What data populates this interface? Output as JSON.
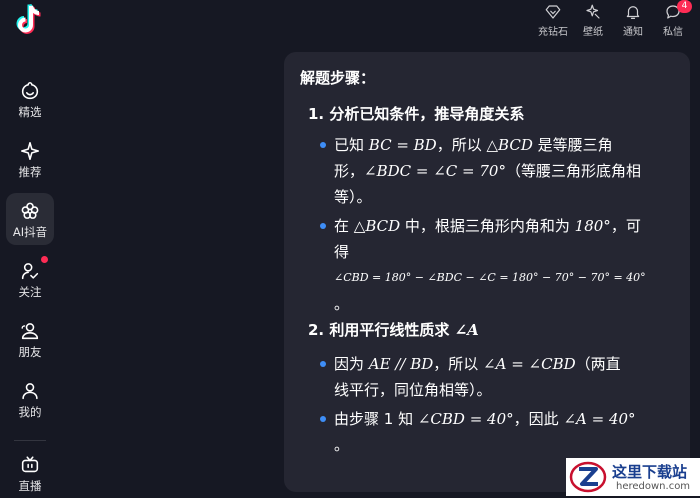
{
  "sidebar": {
    "items": [
      {
        "label": "精选",
        "icon": "smiley-icon"
      },
      {
        "label": "推荐",
        "icon": "sparkle-icon"
      },
      {
        "label": "AI抖音",
        "icon": "flower-icon"
      },
      {
        "label": "关注",
        "icon": "follow-icon"
      },
      {
        "label": "朋友",
        "icon": "friends-icon"
      },
      {
        "label": "我的",
        "icon": "profile-icon"
      },
      {
        "label": "直播",
        "icon": "tv-icon"
      }
    ]
  },
  "topbar": {
    "items": [
      {
        "label": "充钻石",
        "icon": "diamond-icon"
      },
      {
        "label": "壁纸",
        "icon": "wallpaper-icon"
      },
      {
        "label": "通知",
        "icon": "bell-icon"
      },
      {
        "label": "私信",
        "icon": "message-icon",
        "badge": "4"
      }
    ]
  },
  "card": {
    "title": "解题步骤：",
    "step1": {
      "heading": "1. 分析已知条件，推导角度关系",
      "b1_l1a": "已知 ",
      "b1_l1m": "BC = BD",
      "b1_l1b": "，所以 ",
      "b1_l1m2": "△BCD",
      "b1_l1c": " 是等腰三角",
      "b1_l2a": "形，",
      "b1_l2m": "∠BDC = ∠C = 70°",
      "b1_l2b": "（等腰三角形底角相",
      "b1_l3": "等）。",
      "b2_l1a": "在 ",
      "b2_l1m": "△BCD",
      "b2_l1b": " 中，根据三角形内角和为 ",
      "b2_l1m2": "180°",
      "b2_l1c": "，可",
      "b2_l2": "得",
      "b2_l3": "∠CBD = 180° − ∠BDC − ∠C = 180° − 70° − 70° = 40°",
      "b2_l4": "。"
    },
    "step2": {
      "heading_a": "2. 利用平行线性质求 ",
      "heading_m": "∠A",
      "b1_l1a": "因为 ",
      "b1_l1m": "AE // BD",
      "b1_l1b": "，所以 ",
      "b1_l1m2": "∠A = ∠CBD",
      "b1_l1c": "（两直",
      "b1_l2": "线平行，同位角相等）。",
      "b2_l1a": "由步骤 1 知 ",
      "b2_l1m": "∠CBD = 40°",
      "b2_l1b": "，因此 ",
      "b2_l1m2": "∠A = 40°",
      "b2_l2": "。"
    }
  },
  "watermark": {
    "name": "这里下载站",
    "url": "heredown.com"
  },
  "colors": {
    "background": "#161823",
    "card": "#252632",
    "accent": "#fe2c55",
    "bullet": "#3e8ef7"
  }
}
